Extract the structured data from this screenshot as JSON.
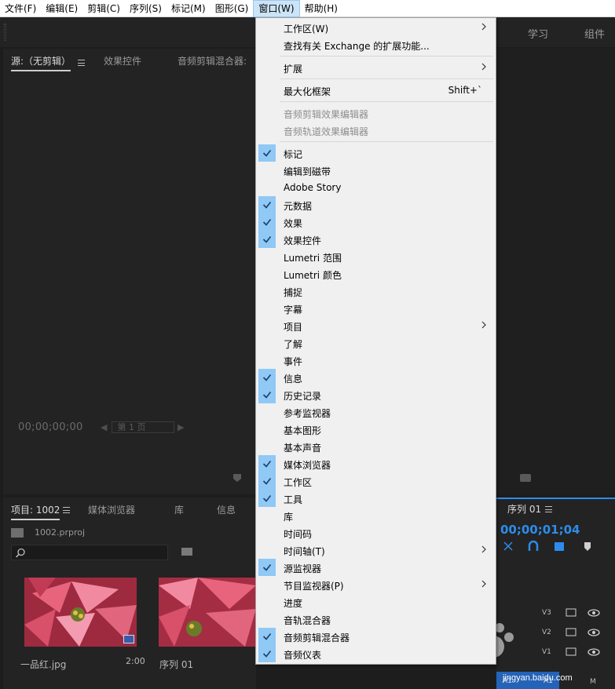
{
  "menubar": {
    "items": [
      {
        "label": "文件(F)"
      },
      {
        "label": "编辑(E)"
      },
      {
        "label": "剪辑(C)"
      },
      {
        "label": "序列(S)"
      },
      {
        "label": "标记(M)"
      },
      {
        "label": "图形(G)"
      },
      {
        "label": "窗口(W)",
        "active": true
      },
      {
        "label": "帮助(H)"
      }
    ]
  },
  "workspace_tabs": {
    "learn": "学习",
    "assembly": "组件"
  },
  "source_panel": {
    "tabs": {
      "source": "源:（无剪辑）",
      "effect_controls": "效果控件",
      "audio_mixer": "音频剪辑混合器:"
    },
    "timecode": "00;00;00;00",
    "page_select": "第 1 页"
  },
  "project_panel": {
    "tabs": {
      "project": "项目: 1002",
      "media_browser": "媒体浏览器",
      "library": "库",
      "info": "信息"
    },
    "file_name": "1002.prproj",
    "items": [
      {
        "name": "一品红.jpg",
        "duration": "2:00"
      },
      {
        "name": "序列 01",
        "duration": ""
      }
    ]
  },
  "sequence_panel": {
    "title": "序列 01",
    "timecode": "00;00;01;04",
    "tracks": [
      {
        "name": "V3"
      },
      {
        "name": "V2"
      },
      {
        "name": "V1"
      },
      {
        "name": "A1"
      }
    ],
    "audio_toggle": "M"
  },
  "window_menu": {
    "items": [
      {
        "label": "工作区(W)",
        "submenu": true
      },
      {
        "label": "查找有关 Exchange 的扩展功能..."
      },
      {
        "sep": true
      },
      {
        "label": "扩展",
        "submenu": true
      },
      {
        "sep": true
      },
      {
        "label": "最大化框架",
        "shortcut": "Shift+`"
      },
      {
        "sep": true
      },
      {
        "label": "音频剪辑效果编辑器",
        "disabled": true
      },
      {
        "label": "音频轨道效果编辑器",
        "disabled": true
      },
      {
        "sep": true
      },
      {
        "label": "标记",
        "checked": true
      },
      {
        "label": "编辑到磁带"
      },
      {
        "label": "Adobe Story"
      },
      {
        "label": "元数据",
        "checked": true
      },
      {
        "label": "效果",
        "checked": true
      },
      {
        "label": "效果控件",
        "checked": true
      },
      {
        "label": "Lumetri 范围"
      },
      {
        "label": "Lumetri 颜色"
      },
      {
        "label": "捕捉"
      },
      {
        "label": "字幕"
      },
      {
        "label": "项目",
        "submenu": true
      },
      {
        "label": "了解"
      },
      {
        "label": "事件"
      },
      {
        "label": "信息",
        "checked": true
      },
      {
        "label": "历史记录",
        "checked": true
      },
      {
        "label": "参考监视器"
      },
      {
        "label": "基本图形"
      },
      {
        "label": "基本声音"
      },
      {
        "label": "媒体浏览器",
        "checked": true
      },
      {
        "label": "工作区",
        "checked": true
      },
      {
        "label": "工具",
        "checked": true
      },
      {
        "label": "库"
      },
      {
        "label": "时间码"
      },
      {
        "label": "时间轴(T)",
        "submenu": true
      },
      {
        "label": "源监视器",
        "checked": true
      },
      {
        "label": "节目监视器(P)",
        "submenu": true
      },
      {
        "label": "进度"
      },
      {
        "label": "音轨混合器"
      },
      {
        "label": "音频剪辑混合器",
        "checked": true
      },
      {
        "label": "音频仪表",
        "checked": true
      }
    ]
  },
  "watermark": {
    "logo_text": "Bai 经验",
    "url": "jingyan.baidu.com"
  },
  "colors": {
    "accent_blue": "#2d8ceb",
    "check_bg": "#90c8f6",
    "menu_bg": "#f0f0f0",
    "panel_bg": "#232323"
  }
}
